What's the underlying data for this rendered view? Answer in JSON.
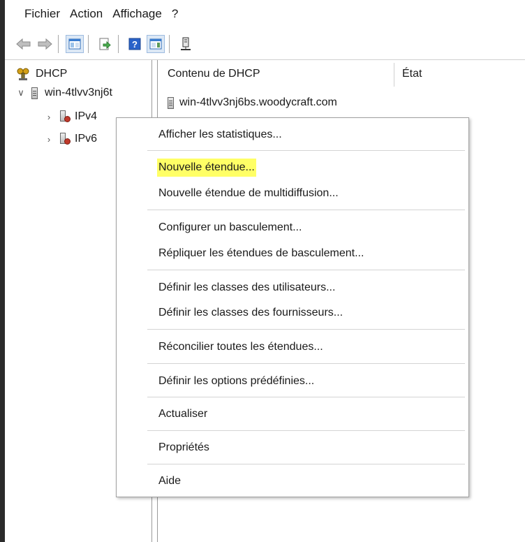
{
  "menubar": {
    "items": [
      "Fichier",
      "Action",
      "Affichage",
      "?"
    ]
  },
  "toolbar": {
    "buttons": [
      "back-icon",
      "forward-icon",
      "show-hide-console-tree-icon",
      "export-list-icon",
      "help-icon",
      "show-hide-action-pane-icon",
      "add-server-icon"
    ]
  },
  "tree": {
    "root_label": "DHCP",
    "server_label": "win-4tlvv3nj6t",
    "ipv4_label": "IPv4",
    "ipv6_label": "IPv6"
  },
  "content": {
    "col_name": "Contenu de DHCP",
    "col_status": "État",
    "rows": [
      {
        "name": "win-4tlvv3nj6bs.woodycraft.com"
      }
    ]
  },
  "context_menu": {
    "items": [
      "Afficher les statistiques...",
      "Nouvelle étendue...",
      "Nouvelle étendue de multidiffusion...",
      "Configurer un basculement...",
      "Répliquer les étendues de basculement...",
      "Définir les classes des utilisateurs...",
      "Définir les classes des fournisseurs...",
      "Réconcilier toutes les étendues...",
      "Définir les options prédéfinies...",
      "Actualiser",
      "Propriétés",
      "Aide"
    ],
    "highlighted_index": 1,
    "highlight_color": "#ffff66"
  }
}
